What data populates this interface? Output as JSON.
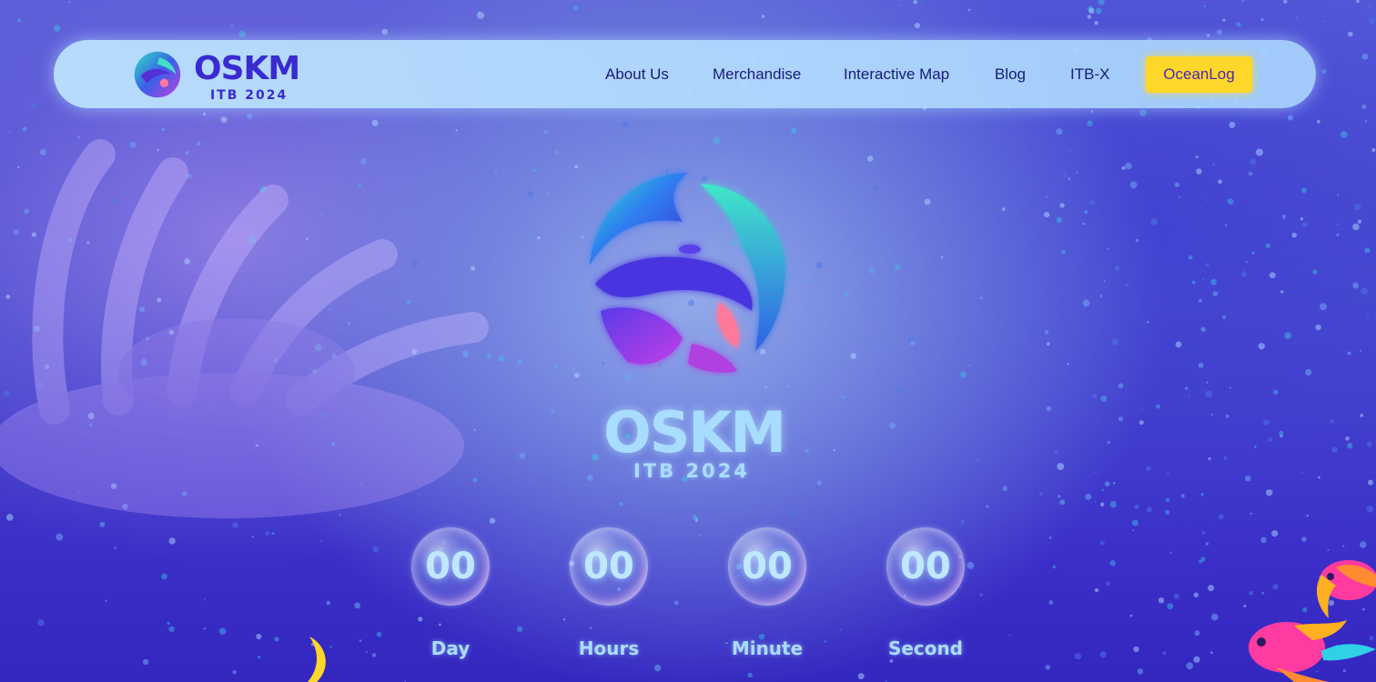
{
  "nav": {
    "logo_word": "OSKM",
    "logo_sub": "ITB 2024",
    "links": [
      {
        "label": "About Us"
      },
      {
        "label": "Merchandise"
      },
      {
        "label": "Interactive Map"
      },
      {
        "label": "Blog"
      },
      {
        "label": "ITB-X"
      }
    ],
    "cta_label": "OceanLog"
  },
  "hero": {
    "word": "OSKM",
    "sub": "ITB 2024"
  },
  "countdown": [
    {
      "value": "00",
      "label": "Day"
    },
    {
      "value": "00",
      "label": "Hours"
    },
    {
      "value": "00",
      "label": "Minute"
    },
    {
      "value": "00",
      "label": "Second"
    }
  ],
  "colors": {
    "nav_bg": "#bfe6ff",
    "nav_text": "#1a1a7a",
    "cta_bg": "#ffd62a",
    "logo_text": "#3a2bd0",
    "hero_text": "#a8ddff"
  }
}
